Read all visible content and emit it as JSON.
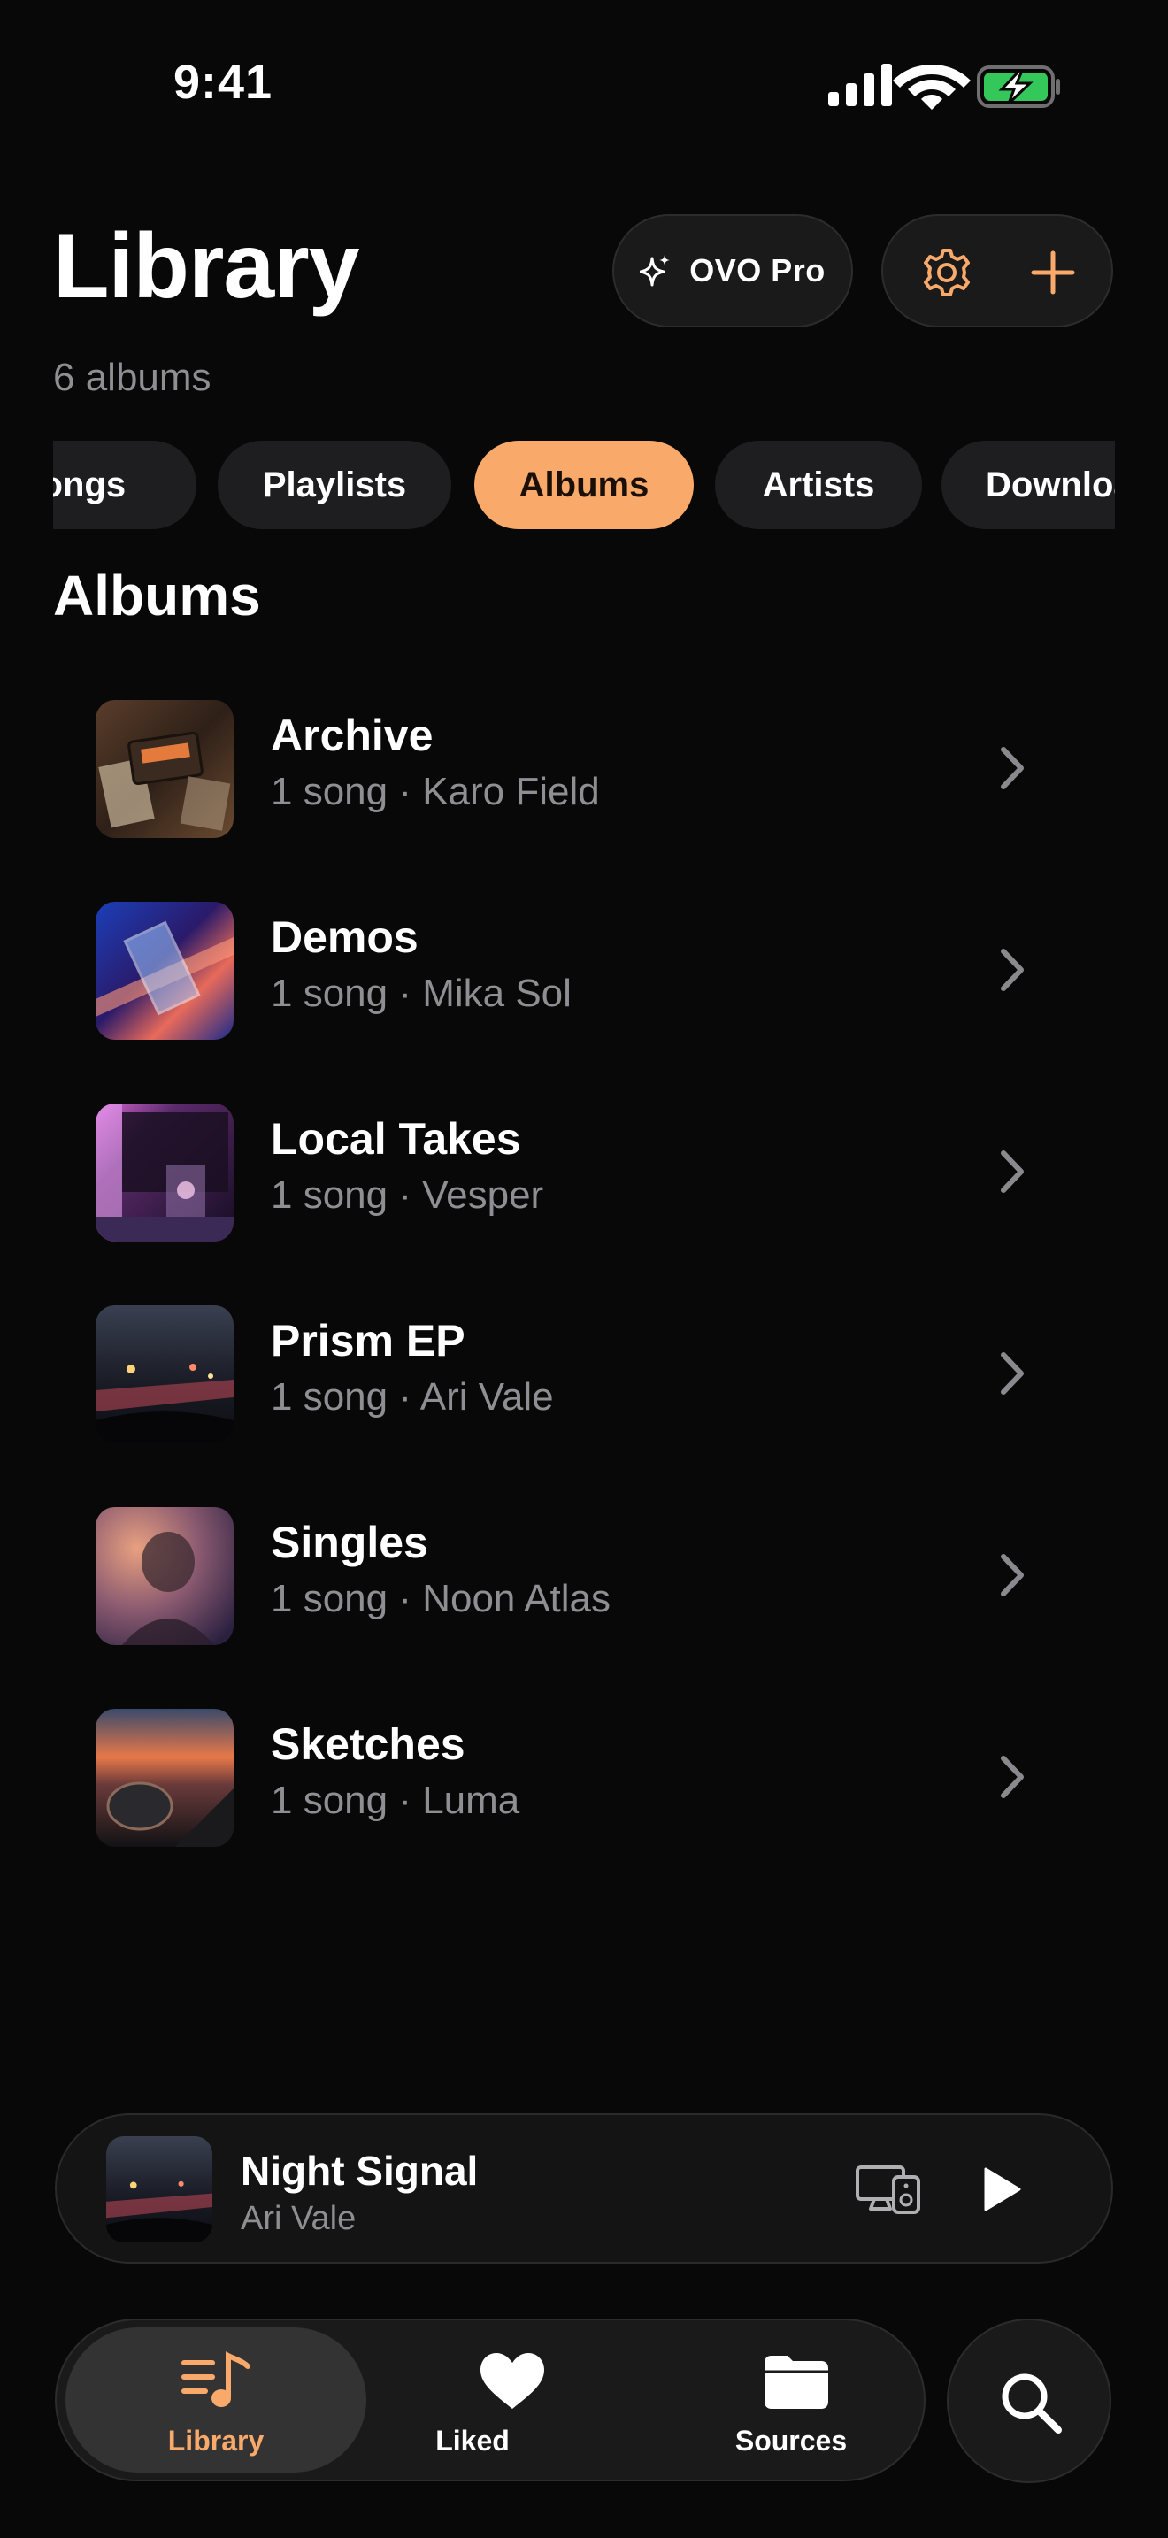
{
  "status_bar": {
    "time": "9:41"
  },
  "header": {
    "title": "Library",
    "subtitle": "6 albums",
    "pro_label": "OVO Pro"
  },
  "filters": [
    {
      "label": "Songs",
      "active": false
    },
    {
      "label": "Playlists",
      "active": false
    },
    {
      "label": "Albums",
      "active": true
    },
    {
      "label": "Artists",
      "active": false
    },
    {
      "label": "Downloads",
      "active": false
    }
  ],
  "section_title": "Albums",
  "albums": [
    {
      "name": "Archive",
      "meta": "1 song · Karo Field"
    },
    {
      "name": "Demos",
      "meta": "1 song · Mika Sol"
    },
    {
      "name": "Local Takes",
      "meta": "1 song · Vesper"
    },
    {
      "name": "Prism EP",
      "meta": "1 song · Ari Vale"
    },
    {
      "name": "Singles",
      "meta": "1 song · Noon Atlas"
    },
    {
      "name": "Sketches",
      "meta": "1 song · Luma"
    }
  ],
  "now_playing": {
    "title": "Night Signal",
    "artist": "Ari Vale"
  },
  "tab_bar": [
    {
      "label": "Library",
      "icon": "library-music-icon",
      "active": true
    },
    {
      "label": "Liked",
      "icon": "heart-icon",
      "active": false
    },
    {
      "label": "Sources",
      "icon": "folder-icon",
      "active": false
    }
  ],
  "colors": {
    "accent": "#F9A96A",
    "background": "#090808",
    "surface": "#1E1E20",
    "secondary_text": "#8E8E93"
  }
}
